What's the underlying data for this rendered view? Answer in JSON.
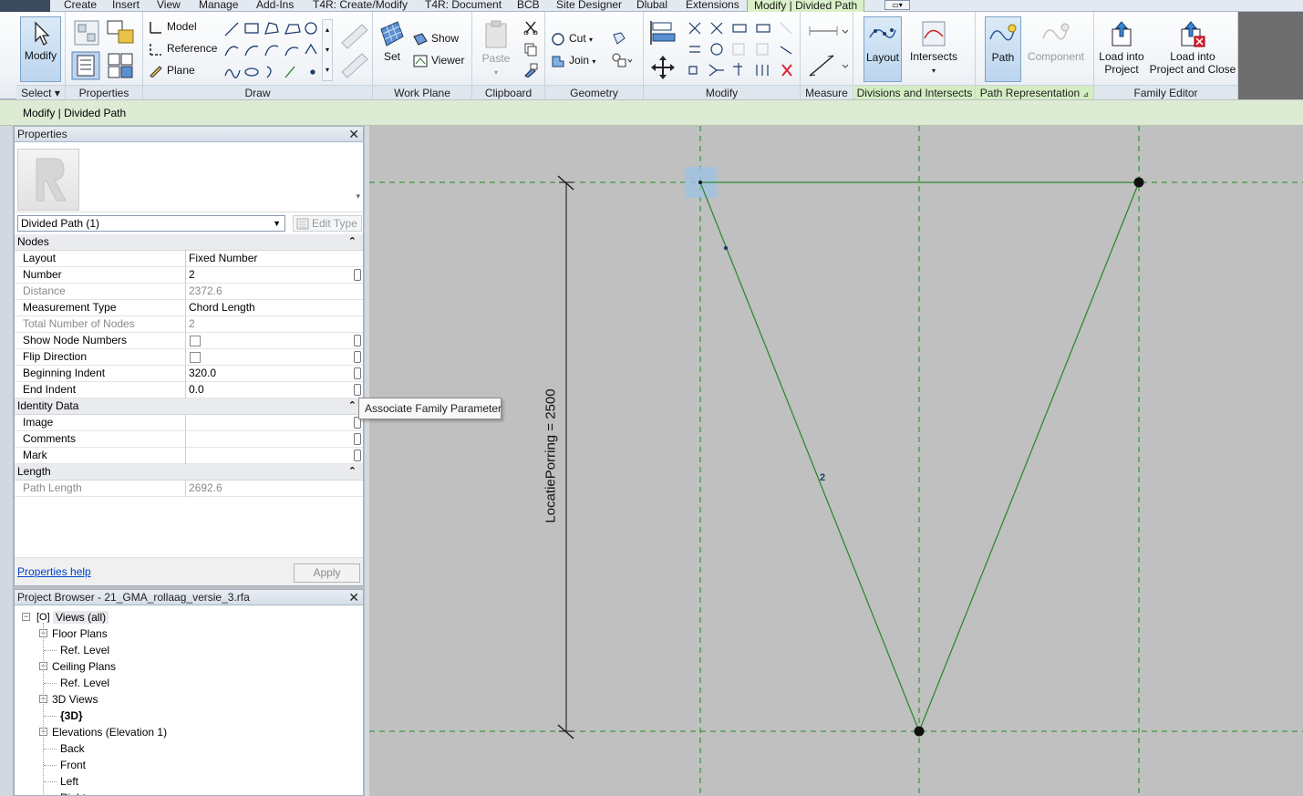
{
  "ribbon": {
    "tabs": [
      "Create",
      "Insert",
      "View",
      "Manage",
      "Add-Ins",
      "T4R: Create/Modify",
      "T4R: Document",
      "BCB",
      "Site Designer",
      "Dlubal",
      "Extensions",
      "Modify | Divided Path"
    ],
    "groups": {
      "select": "Select",
      "properties": "Properties",
      "draw": "Draw",
      "work_plane": "Work Plane",
      "clipboard": "Clipboard",
      "geometry": "Geometry",
      "modify": "Modify",
      "measure": "Measure",
      "divisions": "Divisions and Intersects",
      "path_rep": "Path Representation",
      "family_editor": "Family Editor"
    },
    "buttons": {
      "modify": "Modify",
      "model": "Model",
      "reference": "Reference",
      "plane": "Plane",
      "set": "Set",
      "show": "Show",
      "viewer": "Viewer",
      "paste": "Paste",
      "cut": "Cut",
      "join": "Join",
      "layout": "Layout",
      "intersects": "Intersects",
      "path": "Path",
      "component": "Component",
      "load_into_project_1": "Load into",
      "load_into_project_2": "Project",
      "load_close_1": "Load into",
      "load_close_2": "Project and Close"
    }
  },
  "options_bar": {
    "context": "Modify | Divided Path"
  },
  "properties": {
    "title": "Properties",
    "type_selector": "Divided Path (1)",
    "edit_type": "Edit Type",
    "groups": [
      {
        "name": "Nodes",
        "rows": [
          {
            "name": "Layout",
            "value": "Fixed Number",
            "readonly": false,
            "button": false,
            "checkbox": false
          },
          {
            "name": "Number",
            "value": "2",
            "readonly": false,
            "button": true,
            "checkbox": false
          },
          {
            "name": "Distance",
            "value": "2372.6",
            "readonly": true,
            "button": false,
            "checkbox": false
          },
          {
            "name": "Measurement Type",
            "value": "Chord Length",
            "readonly": false,
            "button": false,
            "checkbox": false
          },
          {
            "name": "Total Number of Nodes",
            "value": "2",
            "readonly": true,
            "button": false,
            "checkbox": false
          },
          {
            "name": "Show Node Numbers",
            "value": "",
            "readonly": false,
            "button": true,
            "checkbox": true
          },
          {
            "name": "Flip Direction",
            "value": "",
            "readonly": false,
            "button": true,
            "checkbox": true
          },
          {
            "name": "Beginning Indent",
            "value": "320.0",
            "readonly": false,
            "button": true,
            "checkbox": false
          },
          {
            "name": "End Indent",
            "value": "0.0",
            "readonly": false,
            "button": true,
            "checkbox": false
          }
        ]
      },
      {
        "name": "Identity Data",
        "rows": [
          {
            "name": "Image",
            "value": "",
            "readonly": false,
            "button": true,
            "checkbox": false
          },
          {
            "name": "Comments",
            "value": "",
            "readonly": false,
            "button": true,
            "checkbox": false
          },
          {
            "name": "Mark",
            "value": "",
            "readonly": false,
            "button": true,
            "checkbox": false
          }
        ]
      },
      {
        "name": "Length",
        "rows": [
          {
            "name": "Path Length",
            "value": "2692.6",
            "readonly": true,
            "button": false,
            "checkbox": false
          }
        ]
      }
    ],
    "help_link": "Properties help",
    "apply": "Apply"
  },
  "tooltip": "Associate Family Parameter",
  "project_browser": {
    "title": "Project Browser - 21_GMA_rollaag_versie_3.rfa",
    "nodes": [
      {
        "label": "Views (all)",
        "level": 0,
        "toggle": "-",
        "bold": false
      },
      {
        "label": "Floor Plans",
        "level": 1,
        "toggle": "-",
        "bold": false
      },
      {
        "label": "Ref. Level",
        "level": 2,
        "toggle": "",
        "bold": false
      },
      {
        "label": "Ceiling Plans",
        "level": 1,
        "toggle": "-",
        "bold": false
      },
      {
        "label": "Ref. Level",
        "level": 2,
        "toggle": "",
        "bold": false
      },
      {
        "label": "3D Views",
        "level": 1,
        "toggle": "-",
        "bold": false
      },
      {
        "label": "{3D}",
        "level": 2,
        "toggle": "",
        "bold": true
      },
      {
        "label": "Elevations (Elevation 1)",
        "level": 1,
        "toggle": "-",
        "bold": false
      },
      {
        "label": "Back",
        "level": 2,
        "toggle": "",
        "bold": false
      },
      {
        "label": "Front",
        "level": 2,
        "toggle": "",
        "bold": false
      },
      {
        "label": "Left",
        "level": 2,
        "toggle": "",
        "bold": false
      },
      {
        "label": "Right",
        "level": 2,
        "toggle": "",
        "bold": false
      }
    ]
  },
  "canvas": {
    "dimension_label": "LocatiePorring = 2500",
    "node_number": "2",
    "colors": {
      "line": "#2f8a2f",
      "refplane": "#1f8a1f",
      "background": "#c0c0c0",
      "highlight": "#9cc3e6"
    }
  }
}
